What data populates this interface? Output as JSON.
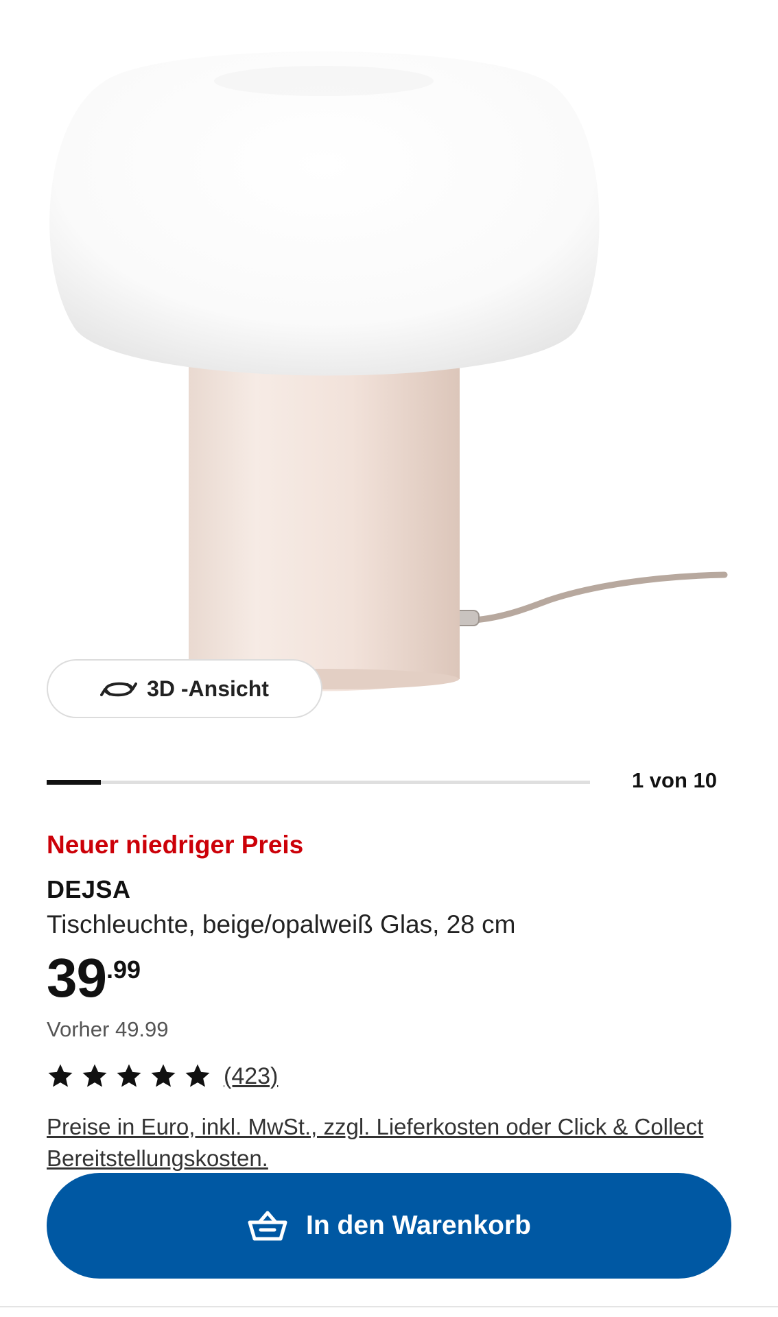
{
  "gallery": {
    "view_3d_label": "3D -Ansicht",
    "current_index": 1,
    "total": 10,
    "counter_text": "1 von 10",
    "progress_fraction": 0.1
  },
  "product": {
    "promo_label": "Neuer niedriger Preis",
    "name": "DEJSA",
    "description": "Tischleuchte, beige/opalweiß Glas, 28 cm",
    "price_integer": "39",
    "price_decimal": ".99",
    "previous_price": "Vorher 49.99",
    "rating": 5,
    "rating_count": "(423)",
    "legal_note": "Preise in Euro, inkl. MwSt., zzgl. Lieferkosten oder Click & Collect Bereitstellungskosten."
  },
  "actions": {
    "add_to_cart_label": "In den Warenkorb"
  },
  "colors": {
    "promo_red": "#cc0008",
    "cart_blue": "#0058a3",
    "lamp_base": "#efe0d8",
    "lamp_shade": "#ffffff"
  },
  "icons": {
    "view_3d": "rotate-3d-icon",
    "cart": "basket-icon",
    "star": "star-icon"
  }
}
